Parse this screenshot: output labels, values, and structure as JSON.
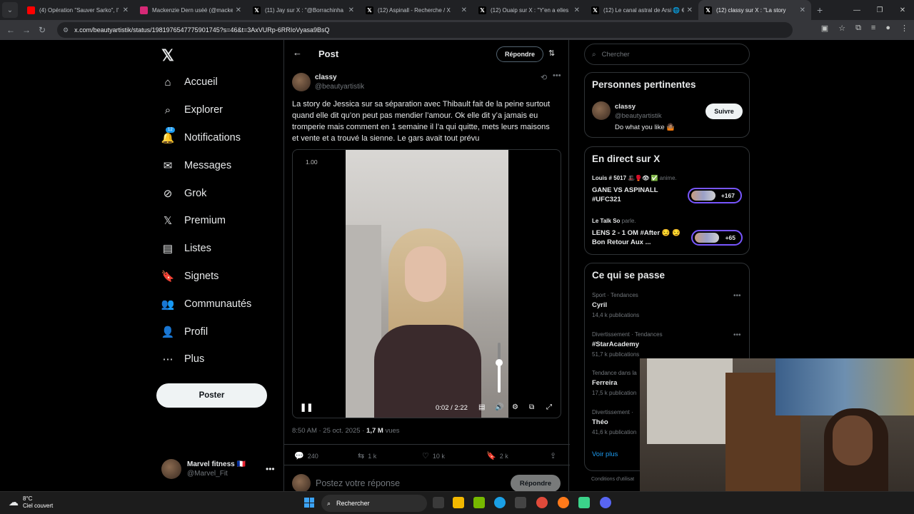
{
  "browser": {
    "tabs": [
      {
        "title": "(4) Opération \"Sauver Sarko\", l’",
        "icon": "youtube-icon",
        "color": "#ff0000"
      },
      {
        "title": "Mackenzie Dern uséé (@macke",
        "icon": "instagram-icon",
        "color": "#d62976"
      },
      {
        "title": "(11) Jay sur X : \"@Borrachinha",
        "icon": "x-logo-icon",
        "color": "#000000"
      },
      {
        "title": "(12) Aspinall - Recherche / X",
        "icon": "x-logo-icon",
        "color": "#000000"
      },
      {
        "title": "(12) Ouaip sur X : \"Y'en a elles",
        "icon": "x-logo-icon",
        "color": "#000000"
      },
      {
        "title": "(12) Le canal astral de Arsi 🌐 €",
        "icon": "x-logo-icon",
        "color": "#000000"
      },
      {
        "title": "(12) classy sur X : \"La story",
        "icon": "x-logo-icon",
        "color": "#000000",
        "active": true
      }
    ],
    "url": "x.com/beautyartistik/status/1981976547775901745?s=46&t=3AxVURp-6RRIoVyasa9BsQ"
  },
  "sidebar": {
    "items": [
      {
        "label": "Accueil",
        "icon": "home-icon"
      },
      {
        "label": "Explorer",
        "icon": "search-icon"
      },
      {
        "label": "Notifications",
        "icon": "bell-icon",
        "badge": "12"
      },
      {
        "label": "Messages",
        "icon": "mail-icon"
      },
      {
        "label": "Grok",
        "icon": "grok-icon"
      },
      {
        "label": "Premium",
        "icon": "x-logo-icon"
      },
      {
        "label": "Listes",
        "icon": "list-icon"
      },
      {
        "label": "Signets",
        "icon": "bookmark-icon"
      },
      {
        "label": "Communautés",
        "icon": "people-icon"
      },
      {
        "label": "Profil",
        "icon": "user-icon"
      },
      {
        "label": "Plus",
        "icon": "more-circle-icon"
      }
    ],
    "post_button": "Poster",
    "account": {
      "name": "Marvel fitness 🇫🇷",
      "handle": "@Marvel_Fit"
    }
  },
  "post": {
    "header_title": "Post",
    "reply_button": "Répondre",
    "author_name": "classy",
    "author_handle": "@beautyartistik",
    "text": "La story de Jessica sur sa séparation avec Thibault fait de la peine surtout quand elle dit qu’on peut pas mendier l’amour. Ok elle dit y’a jamais eu tromperie mais comment en 1 semaine il l’a qui quitte, mets leurs maisons et vente et a trouvé la sienne. Le gars avait tout prévu",
    "video": {
      "speed": "1.00",
      "time": "0:02 / 2:22",
      "volume": 0.6
    },
    "timestamp": "8:50 AM · 25 oct. 2025 · ",
    "views_count": "1,7 M",
    "views_label": " vues",
    "stats": {
      "replies": "240",
      "reposts": "1 k",
      "likes": "10 k",
      "bookmarks": "2 k"
    },
    "reply_placeholder": "Postez votre réponse",
    "reply_submit": "Répondre"
  },
  "right": {
    "search_placeholder": "Chercher",
    "relevant": {
      "title": "Personnes pertinentes",
      "name": "classy",
      "handle": "@beautyartistik",
      "bio": "Do what you like 🤷🏽",
      "follow": "Suivre"
    },
    "live": {
      "title": "En direct sur X",
      "items": [
        {
          "host": "Louis # 5017 🎩🥊👁 ✅",
          "action": " anime.",
          "title": "GANE VS ASPINALL #UFC321",
          "count": "+167"
        },
        {
          "host": "Le Talk So",
          "action": " parle.",
          "title": "LENS 2 - 1 OM #After 😏 😏 Bon Retour Aux ...",
          "count": "+65"
        }
      ]
    },
    "trends": {
      "title": "Ce qui se passe",
      "items": [
        {
          "category": "Sport · Tendances",
          "name": "Cyril",
          "count": "14,4 k publications"
        },
        {
          "category": "Divertissement · Tendances",
          "name": "#StarAcademy",
          "count": "51,7 k publications"
        },
        {
          "category": "Tendance dans la",
          "name": "Ferreira",
          "count": "17,5 k publication"
        },
        {
          "category": "Divertissement ·",
          "name": "Théo",
          "count": "41,6 k publication"
        }
      ],
      "see_more": "Voir plus"
    },
    "footer": "Conditions d'utilisat"
  },
  "taskbar": {
    "temp": "8°C",
    "weather": "Ciel couvert",
    "search": "Rechercher"
  }
}
